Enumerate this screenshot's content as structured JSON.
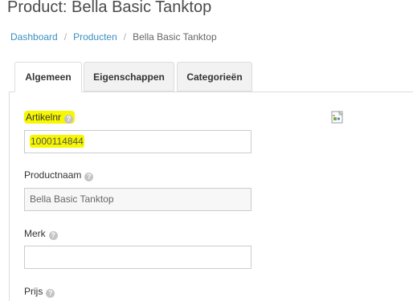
{
  "page": {
    "title": "Product: Bella Basic Tanktop"
  },
  "breadcrumb": {
    "items": [
      "Dashboard",
      "Producten",
      "Bella Basic Tanktop"
    ],
    "separator": "/"
  },
  "tabs": [
    {
      "label": "Algemeen",
      "active": true
    },
    {
      "label": "Eigenschappen",
      "active": false
    },
    {
      "label": "Categorieën",
      "active": false
    }
  ],
  "form": {
    "fields": [
      {
        "label": "Artikelnr",
        "value": "1000114844",
        "help": "?"
      },
      {
        "label": "Productnaam",
        "value": "Bella Basic Tanktop",
        "help": "?"
      },
      {
        "label": "Merk",
        "value": "",
        "help": "?"
      },
      {
        "label": "Prijs",
        "help": "?"
      }
    ]
  },
  "image": {
    "icon": "broken-image-icon"
  },
  "colors": {
    "link": "#3d8fc2",
    "highlight": "#f7f700",
    "tab_border": "#dddddd"
  }
}
